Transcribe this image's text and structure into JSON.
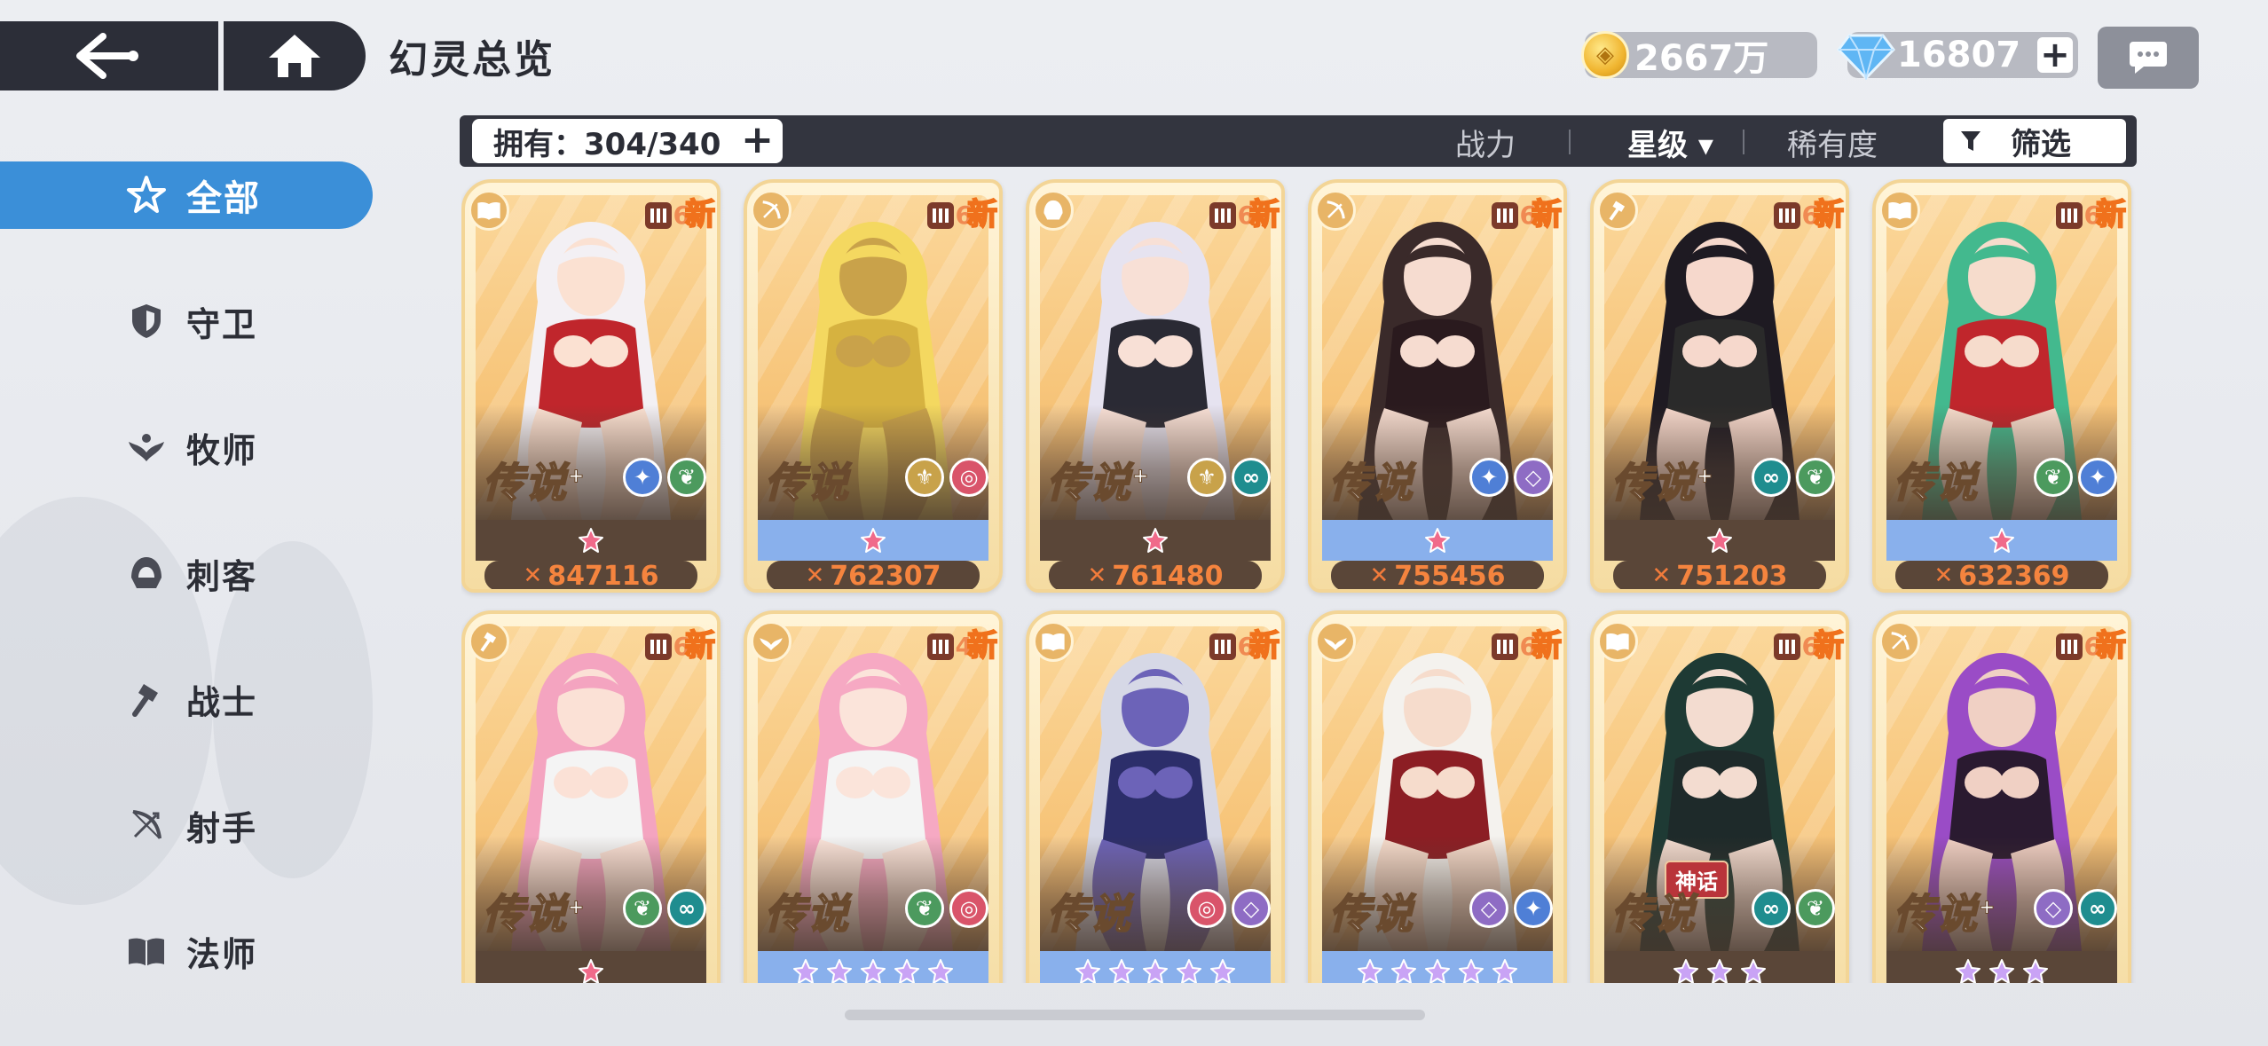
{
  "header": {
    "title": "幻灵总览",
    "gold": "2667万",
    "gems": "16807",
    "gem_plus": "+"
  },
  "sidebar": {
    "items": [
      {
        "label": "全部",
        "icon": "all-star-icon",
        "active": true
      },
      {
        "label": "守卫",
        "icon": "shield-icon"
      },
      {
        "label": "牧师",
        "icon": "wings-icon"
      },
      {
        "label": "刺客",
        "icon": "hood-icon"
      },
      {
        "label": "战士",
        "icon": "hammer-icon"
      },
      {
        "label": "射手",
        "icon": "bow-icon"
      },
      {
        "label": "法师",
        "icon": "book-icon"
      }
    ]
  },
  "toolbar": {
    "owned_label": "拥有：304/340",
    "owned_plus": "+",
    "sort_power": "战力",
    "sort_star": "星级",
    "sort_star_arrow": "▾",
    "sort_rarity": "稀有度",
    "filter_label": "筛选",
    "divider": "|"
  },
  "cards": [
    {
      "role": "book-icon",
      "level": "6",
      "new": "新",
      "rarity": "传说",
      "plus": "+",
      "stars": 1,
      "star_bar": "dark",
      "power": "847116",
      "elements": [
        "ice",
        "nature"
      ],
      "myth": ""
    },
    {
      "role": "bow-icon",
      "level": "6",
      "new": "新",
      "rarity": "传说",
      "plus": "",
      "stars": 1,
      "star_bar": "blue",
      "power": "762307",
      "elements": [
        "light",
        "fire"
      ],
      "myth": ""
    },
    {
      "role": "hood-icon",
      "level": "6",
      "new": "新",
      "rarity": "传说",
      "plus": "+",
      "stars": 1,
      "star_bar": "dark",
      "power": "761480",
      "elements": [
        "light",
        "water"
      ],
      "myth": ""
    },
    {
      "role": "bow-icon",
      "level": "6",
      "new": "新",
      "rarity": "传说",
      "plus": "",
      "stars": 1,
      "star_bar": "blue",
      "power": "755456",
      "elements": [
        "ice",
        "dark"
      ],
      "myth": ""
    },
    {
      "role": "hammer-icon",
      "level": "6",
      "new": "新",
      "rarity": "传说",
      "plus": "+",
      "stars": 1,
      "star_bar": "dark",
      "power": "751203",
      "elements": [
        "water",
        "nature"
      ],
      "myth": ""
    },
    {
      "role": "book-icon",
      "level": "6",
      "new": "新",
      "rarity": "传说",
      "plus": "",
      "stars": 1,
      "star_bar": "blue",
      "power": "632369",
      "elements": [
        "nature",
        "ice"
      ],
      "myth": ""
    },
    {
      "role": "hammer-icon",
      "level": "6",
      "new": "新",
      "rarity": "传说",
      "plus": "+",
      "stars": 1,
      "star_bar": "dark",
      "power": "",
      "elements": [
        "nature",
        "water"
      ],
      "myth": ""
    },
    {
      "role": "wings-icon",
      "level": "4",
      "new": "新",
      "rarity": "传说",
      "plus": "",
      "stars": 5,
      "star_bar": "blue",
      "power": "",
      "elements": [
        "nature",
        "fire"
      ],
      "myth": ""
    },
    {
      "role": "book-icon",
      "level": "6",
      "new": "新",
      "rarity": "传说",
      "plus": "",
      "stars": 5,
      "star_bar": "blue",
      "power": "",
      "elements": [
        "fire",
        "dark"
      ],
      "myth": ""
    },
    {
      "role": "wings-icon",
      "level": "6",
      "new": "新",
      "rarity": "传说",
      "plus": "",
      "stars": 5,
      "star_bar": "blue",
      "power": "",
      "elements": [
        "dark",
        "ice"
      ],
      "myth": ""
    },
    {
      "role": "book-icon",
      "level": "6",
      "new": "新",
      "rarity": "传说",
      "plus": "",
      "stars": 3,
      "star_bar": "dark",
      "power": "",
      "elements": [
        "water",
        "nature"
      ],
      "myth": "神话"
    },
    {
      "role": "bow-icon",
      "level": "6",
      "new": "新",
      "rarity": "传说",
      "plus": "+",
      "stars": 3,
      "star_bar": "dark",
      "power": "",
      "elements": [
        "dark",
        "water"
      ],
      "myth": ""
    }
  ],
  "colors": {
    "accent": "#3b8fd8",
    "dark_bar": "#33353f",
    "card_gold": "#f3d596",
    "power_text": "#f5843e",
    "star_pink": "#f06a8a",
    "star_purple": "#c9a3f5"
  }
}
